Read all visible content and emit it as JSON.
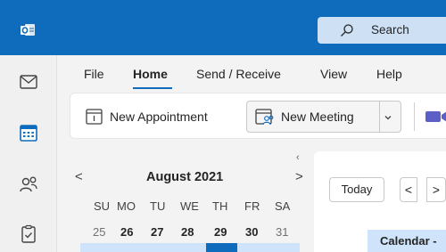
{
  "titlebar": {
    "app_icon": "outlook-icon",
    "search": {
      "icon": "search-icon",
      "label": "Search"
    }
  },
  "rail": {
    "items": [
      {
        "name": "mail",
        "icon": "mail-icon"
      },
      {
        "name": "calendar",
        "icon": "calendar-icon"
      },
      {
        "name": "people",
        "icon": "people-icon"
      },
      {
        "name": "tasks",
        "icon": "tasks-icon"
      }
    ]
  },
  "menu": {
    "tabs": [
      "File",
      "Home",
      "Send / Receive",
      "View",
      "Help"
    ],
    "active": "Home"
  },
  "toolbar": {
    "new_appointment": "New Appointment",
    "new_meeting": "New Meeting",
    "video_icon": "video-icon"
  },
  "mini_calendar": {
    "month": "August 2021",
    "prev": "<",
    "next": ">",
    "collapse": "‹",
    "weekdays": [
      "SU",
      "MO",
      "TU",
      "WE",
      "TH",
      "FR",
      "SA"
    ],
    "days": [
      {
        "d": "25",
        "current": false
      },
      {
        "d": "26",
        "current": true
      },
      {
        "d": "27",
        "current": true
      },
      {
        "d": "28",
        "current": true
      },
      {
        "d": "29",
        "current": true
      },
      {
        "d": "30",
        "current": true
      },
      {
        "d": "31",
        "current": false
      }
    ]
  },
  "calendar_pane": {
    "today": "Today",
    "prev": "<",
    "next": ">",
    "tab": "Calendar -"
  },
  "colors": {
    "brand": "#0f6cbd",
    "highlight": "#cfe4fa",
    "search_bg": "#cde0f4"
  }
}
